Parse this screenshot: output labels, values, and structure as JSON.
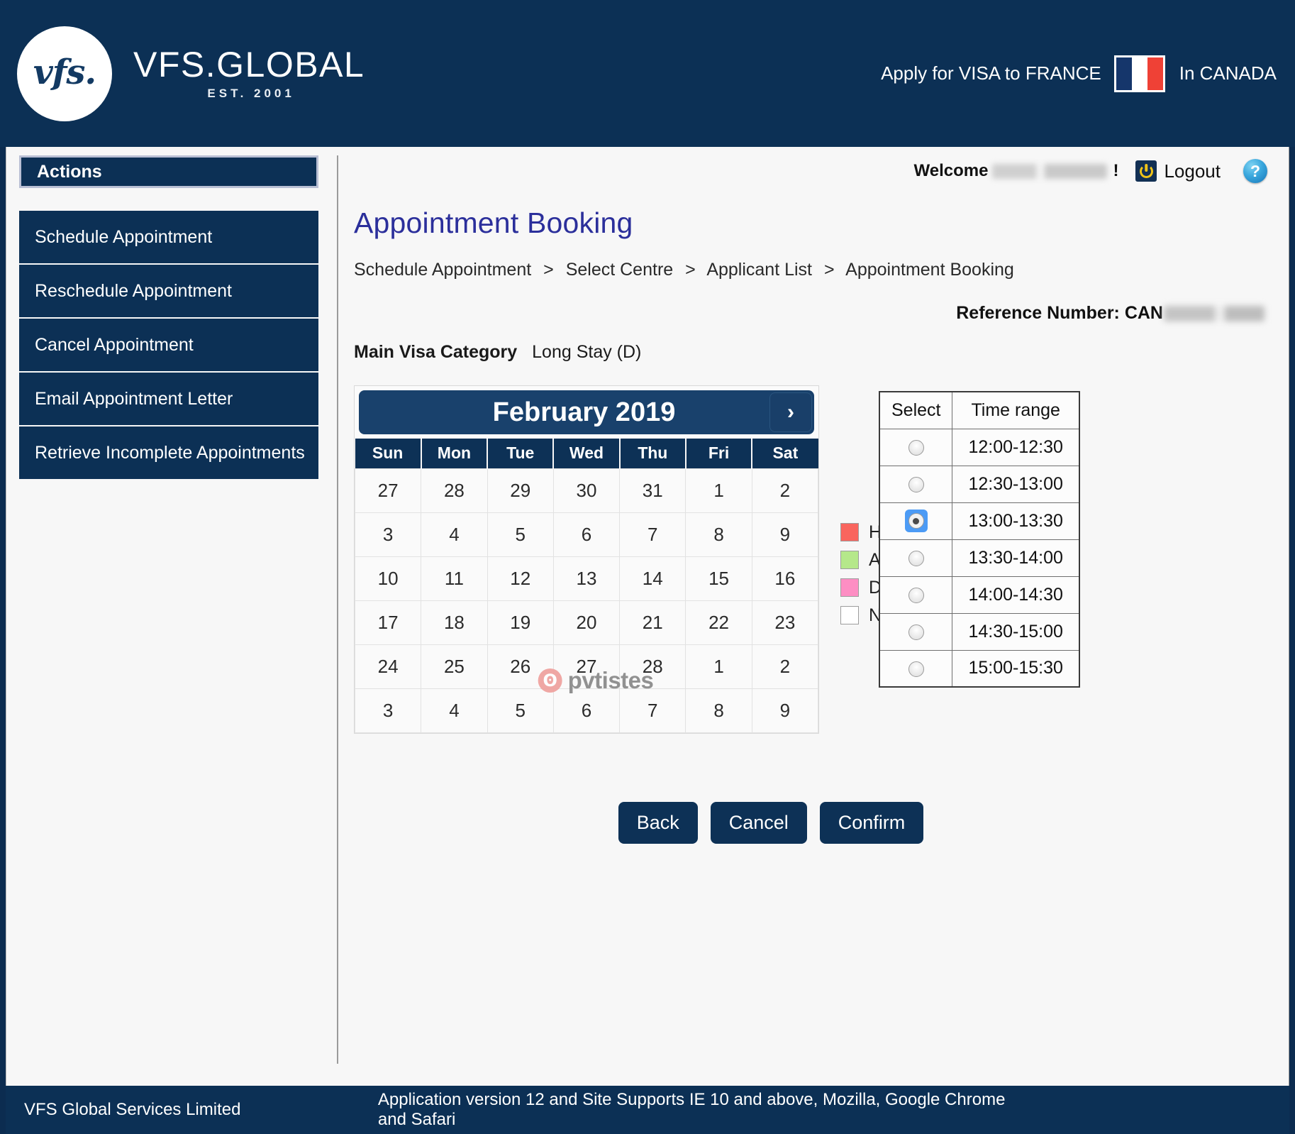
{
  "brand": {
    "logo_mark": "vfs.",
    "name": "VFS.GLOBAL",
    "established": "EST. 2001",
    "apply_text": "Apply for VISA to FRANCE",
    "country_text": "In CANADA",
    "flag_icon": "france-flag-icon",
    "brand_navy": "#0c3055"
  },
  "account": {
    "welcome_label": "Welcome",
    "user_name_redacted": "",
    "exclamation": "!",
    "logout_label": "Logout",
    "power_icon": "power-icon",
    "help_icon": "help-question-icon",
    "help_glyph": "?"
  },
  "sidebar": {
    "header": "Actions",
    "items": [
      {
        "label": "Schedule Appointment"
      },
      {
        "label": "Reschedule Appointment"
      },
      {
        "label": "Cancel Appointment"
      },
      {
        "label": "Email Appointment Letter"
      },
      {
        "label": "Retrieve Incomplete Appointments"
      }
    ]
  },
  "main": {
    "title": "Appointment Booking",
    "breadcrumb": [
      "Schedule Appointment",
      "Select Centre",
      "Applicant List",
      "Appointment Booking"
    ],
    "breadcrumb_separator": ">",
    "reference_label": "Reference Number: CAN",
    "visa_category_label": "Main Visa Category",
    "visa_category_value": "Long Stay (D)"
  },
  "calendar": {
    "month_title": "February 2019",
    "next_icon": "chevron-right-icon",
    "next_glyph": "›",
    "weekdays": [
      "Sun",
      "Mon",
      "Tue",
      "Wed",
      "Thu",
      "Fri",
      "Sat"
    ],
    "weeks": [
      [
        {
          "d": "27",
          "state": "muted"
        },
        {
          "d": "28",
          "state": "muted"
        },
        {
          "d": "29",
          "state": "muted"
        },
        {
          "d": "30",
          "state": "muted"
        },
        {
          "d": "31",
          "state": "muted"
        },
        {
          "d": "1",
          "state": "normal"
        },
        {
          "d": "2",
          "state": "weekend"
        }
      ],
      [
        {
          "d": "3",
          "state": "weekend"
        },
        {
          "d": "4",
          "state": "normal"
        },
        {
          "d": "5",
          "state": "normal"
        },
        {
          "d": "6",
          "state": "normal"
        },
        {
          "d": "7",
          "state": "normal"
        },
        {
          "d": "8",
          "state": "normal"
        },
        {
          "d": "9",
          "state": "weekend"
        }
      ],
      [
        {
          "d": "10",
          "state": "weekend"
        },
        {
          "d": "11",
          "state": "normal"
        },
        {
          "d": "12",
          "state": "normal"
        },
        {
          "d": "13",
          "state": "normal"
        },
        {
          "d": "14",
          "state": "normal"
        },
        {
          "d": "15",
          "state": "normal"
        },
        {
          "d": "16",
          "state": "weekend"
        }
      ],
      [
        {
          "d": "17",
          "state": "weekend"
        },
        {
          "d": "18",
          "state": "normal"
        },
        {
          "d": "19",
          "state": "today"
        },
        {
          "d": "20",
          "state": "available"
        },
        {
          "d": "21",
          "state": "available"
        },
        {
          "d": "22",
          "state": "selected"
        },
        {
          "d": "23",
          "state": "weekend"
        }
      ],
      [
        {
          "d": "24",
          "state": "weekend"
        },
        {
          "d": "25",
          "state": "available"
        },
        {
          "d": "26",
          "state": "available"
        },
        {
          "d": "27",
          "state": "available"
        },
        {
          "d": "28",
          "state": "available"
        },
        {
          "d": "1",
          "state": "blank"
        },
        {
          "d": "2",
          "state": "blank"
        }
      ],
      [
        {
          "d": "3",
          "state": "blank"
        },
        {
          "d": "4",
          "state": "blank"
        },
        {
          "d": "5",
          "state": "blank"
        },
        {
          "d": "6",
          "state": "blank"
        },
        {
          "d": "7",
          "state": "blank"
        },
        {
          "d": "8",
          "state": "blank"
        },
        {
          "d": "9",
          "state": "blank"
        }
      ]
    ],
    "watermark": {
      "glyph": "ʘ",
      "text": "pvtistes"
    }
  },
  "legend": [
    {
      "label": "Holidays",
      "color": "#f9655e"
    },
    {
      "label": "Available",
      "color": "#b5e88a"
    },
    {
      "label": "Date Selected",
      "color": "#fd8ec3"
    },
    {
      "label": "Not Available",
      "color": "#ffffff"
    }
  ],
  "time_table": {
    "headers": [
      "Select",
      "Time range"
    ],
    "rows": [
      {
        "time": "12:00-12:30",
        "selected": false
      },
      {
        "time": "12:30-13:00",
        "selected": false
      },
      {
        "time": "13:00-13:30",
        "selected": true
      },
      {
        "time": "13:30-14:00",
        "selected": false
      },
      {
        "time": "14:00-14:30",
        "selected": false
      },
      {
        "time": "14:30-15:00",
        "selected": false
      },
      {
        "time": "15:00-15:30",
        "selected": false
      }
    ]
  },
  "buttons": {
    "back": "Back",
    "cancel": "Cancel",
    "confirm": "Confirm"
  },
  "footer": {
    "left": "VFS Global Services Limited",
    "right": "Application version 12 and Site Supports IE 10 and above, Mozilla, Google Chrome and Safari"
  }
}
